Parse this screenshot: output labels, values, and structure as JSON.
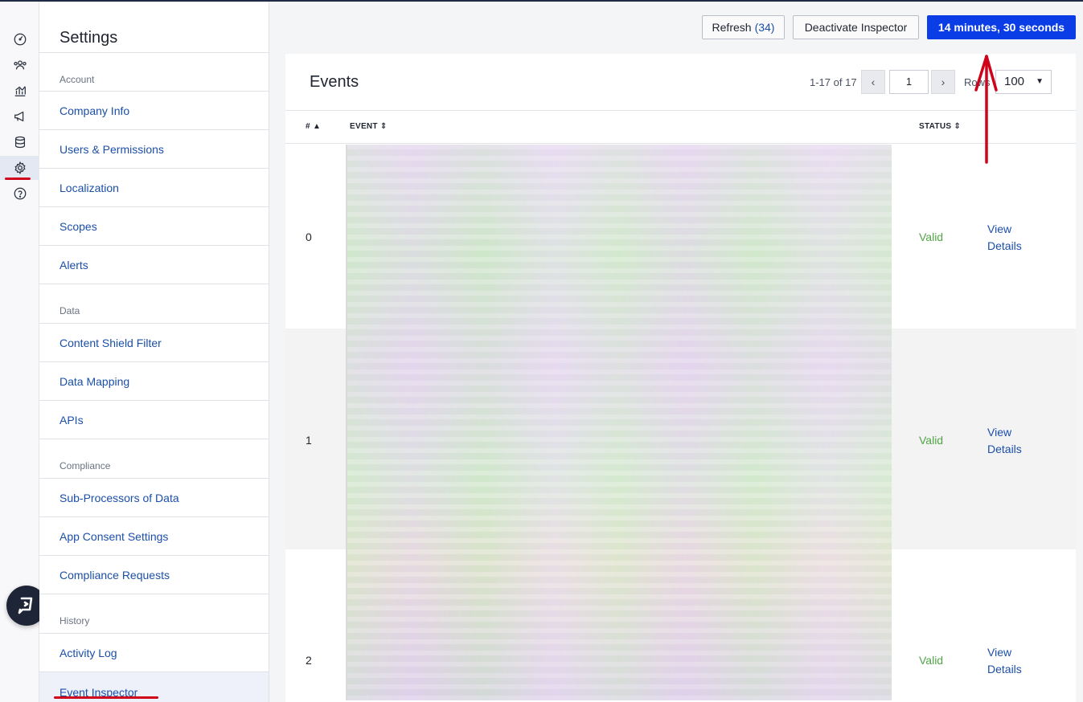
{
  "rail": {
    "icons": [
      "dashboard-icon",
      "audience-icon",
      "analytics-icon",
      "campaigns-icon",
      "database-icon",
      "settings-icon",
      "help-circle-icon"
    ],
    "active": "settings-icon",
    "help_button_icon": "chat-help-icon"
  },
  "settings": {
    "title": "Settings",
    "sections": [
      {
        "label": "Account",
        "items": [
          "Company Info",
          "Users & Permissions",
          "Localization",
          "Scopes",
          "Alerts"
        ]
      },
      {
        "label": "Data",
        "items": [
          "Content Shield Filter",
          "Data Mapping",
          "APIs"
        ]
      },
      {
        "label": "Compliance",
        "items": [
          "Sub-Processors of Data",
          "App Consent Settings",
          "Compliance Requests"
        ]
      },
      {
        "label": "History",
        "items": [
          "Activity Log",
          "Event Inspector"
        ]
      }
    ],
    "active_item": "Event Inspector"
  },
  "toolbar": {
    "refresh_label": "Refresh",
    "refresh_count": "(34)",
    "deactivate_label": "Deactivate Inspector",
    "timer_label": "14 minutes, 30 seconds"
  },
  "events": {
    "title": "Events",
    "pager_info": "1-17 of 17",
    "page": "1",
    "rows_label": "Rows",
    "rows_value": "100",
    "columns": {
      "num": "#",
      "event": "EVENT",
      "status": "STATUS"
    },
    "rows": [
      {
        "num": "0",
        "status": "Valid",
        "link_line1": "View",
        "link_line2": "Details"
      },
      {
        "num": "1",
        "status": "Valid",
        "link_line1": "View",
        "link_line2": "Details"
      },
      {
        "num": "2",
        "status": "Valid",
        "link_line1": "View",
        "link_line2": "Details"
      }
    ]
  },
  "colors": {
    "primary": "#0a3de6",
    "link": "#1b4fa8",
    "valid": "#52a447",
    "annotation": "#d0021b"
  }
}
